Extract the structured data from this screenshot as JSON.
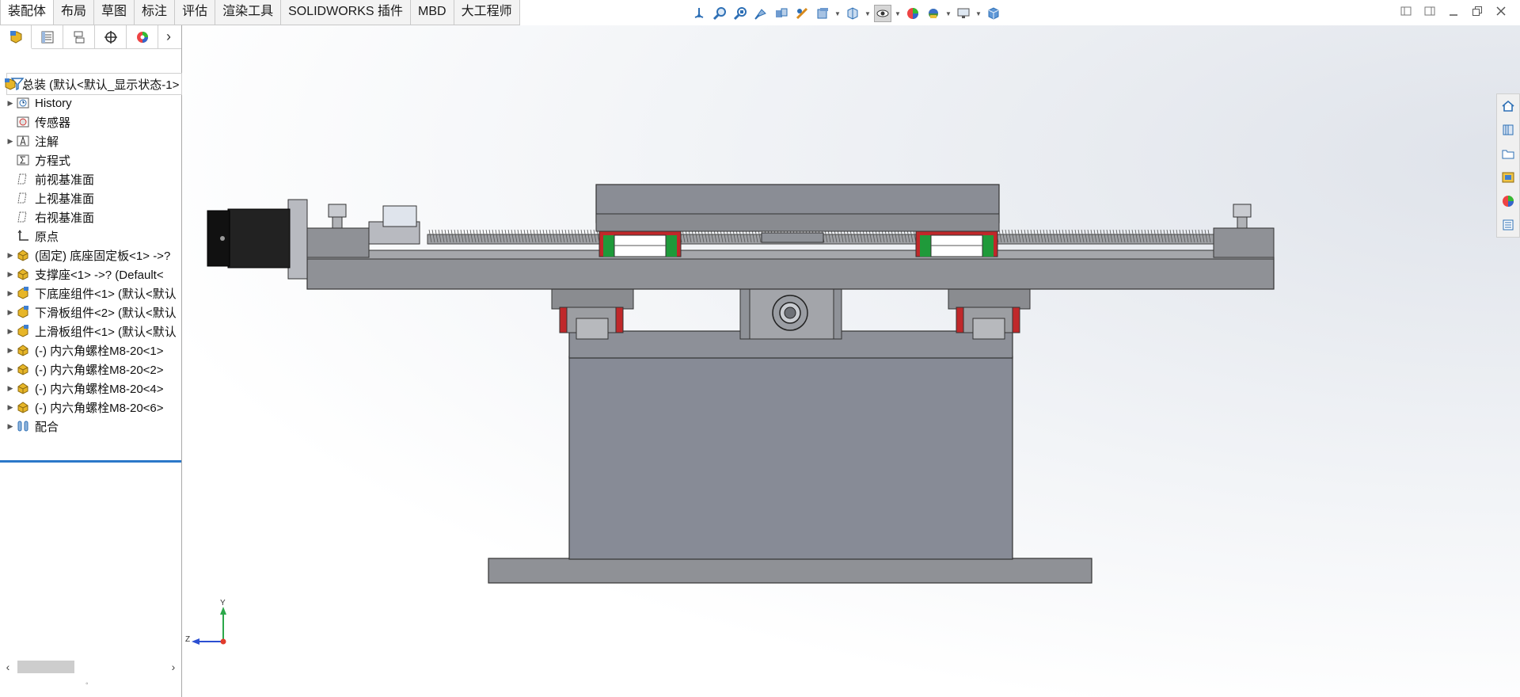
{
  "tabs": [
    "装配体",
    "布局",
    "草图",
    "标注",
    "评估",
    "渲染工具",
    "SOLIDWORKS 插件",
    "MBD",
    "大工程师"
  ],
  "active_tab_index": 0,
  "hud_icons": [
    "view-orientation-icon",
    "zoom-to-fit-icon",
    "zoom-to-area-icon",
    "previous-view-icon",
    "section-view-icon",
    "dynamic-annotation-icon",
    "display-style-icon",
    "hide-show-icon",
    "edit-appearance-icon",
    "apply-scene-icon",
    "view-settings-icon",
    "cube-view-icon"
  ],
  "feature_tree": {
    "filter_icon": "filter-icon",
    "root": "总装 (默认<默认_显示状态-1>",
    "items": [
      {
        "label": "History",
        "icon": "history-icon",
        "arrow": true
      },
      {
        "label": "传感器",
        "icon": "sensor-icon",
        "arrow": false
      },
      {
        "label": "注解",
        "icon": "annotation-icon",
        "arrow": true
      },
      {
        "label": "方程式",
        "icon": "equation-icon",
        "arrow": false
      },
      {
        "label": "前视基准面",
        "icon": "plane-icon",
        "arrow": false
      },
      {
        "label": "上视基准面",
        "icon": "plane-icon",
        "arrow": false
      },
      {
        "label": "右视基准面",
        "icon": "plane-icon",
        "arrow": false
      },
      {
        "label": "原点",
        "icon": "origin-icon",
        "arrow": false
      },
      {
        "label": "(固定) 底座固定板<1> ->?",
        "icon": "part-icon",
        "arrow": true
      },
      {
        "label": "支撑座<1> ->? (Default<",
        "icon": "part-icon",
        "arrow": true
      },
      {
        "label": "下底座组件<1> (默认<默认",
        "icon": "subassembly-icon",
        "arrow": true
      },
      {
        "label": "下滑板组件<2> (默认<默认",
        "icon": "subassembly-icon",
        "arrow": true
      },
      {
        "label": "上滑板组件<1> (默认<默认",
        "icon": "subassembly-icon",
        "arrow": true
      },
      {
        "label": "(-) 内六角螺栓M8-20<1>",
        "icon": "part-icon",
        "arrow": true
      },
      {
        "label": "(-) 内六角螺栓M8-20<2>",
        "icon": "part-icon",
        "arrow": true
      },
      {
        "label": "(-) 内六角螺栓M8-20<4>",
        "icon": "part-icon",
        "arrow": true
      },
      {
        "label": "(-) 内六角螺栓M8-20<6>",
        "icon": "part-icon",
        "arrow": true
      },
      {
        "label": "配合",
        "icon": "mates-icon",
        "arrow": true
      }
    ]
  },
  "triad": {
    "y": "Y",
    "z": "Z"
  },
  "task_pane_icons": [
    "home-icon",
    "design-library-icon",
    "file-explorer-icon",
    "view-palette-icon",
    "appearances-icon",
    "custom-properties-icon"
  ],
  "colors": {
    "accent": "#2b78c9",
    "model_gray": "#8a8d95",
    "rail_red": "#c0282a",
    "rail_green": "#1f9a3a"
  }
}
